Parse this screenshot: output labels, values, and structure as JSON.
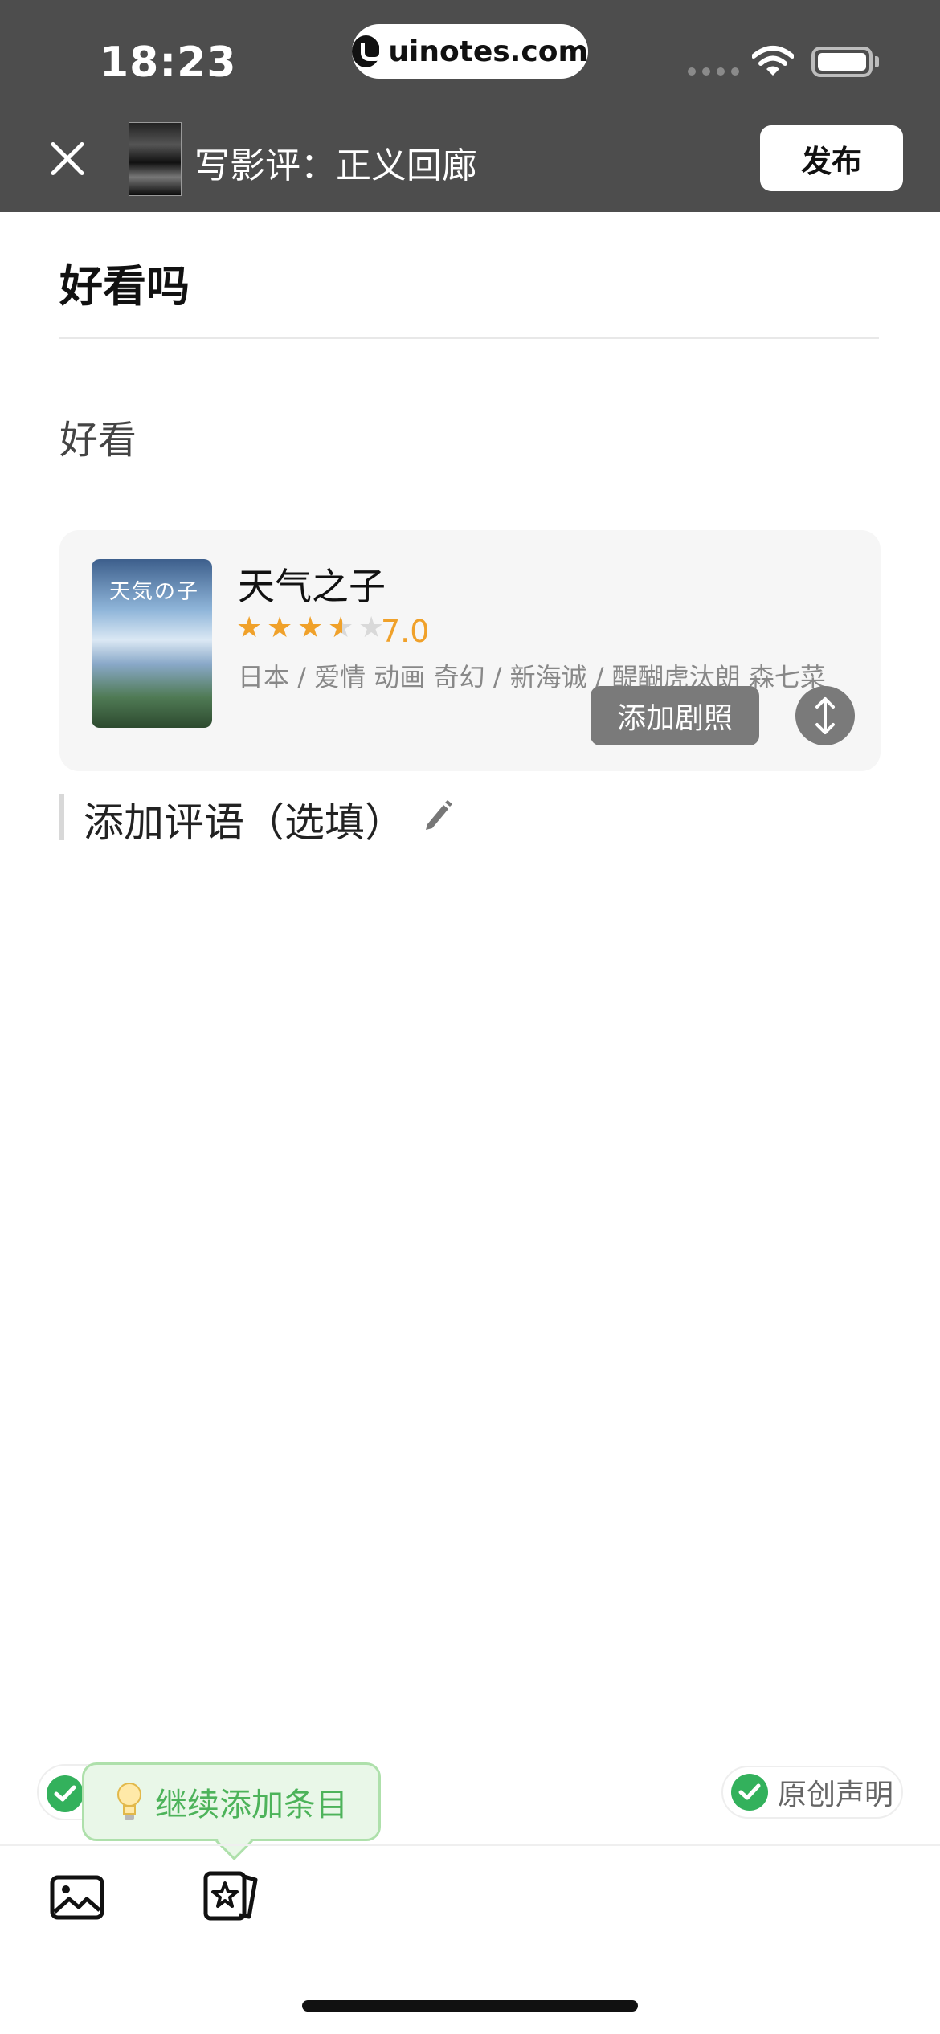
{
  "status_bar": {
    "time": "18:23",
    "url": "uinotes.com"
  },
  "header": {
    "title": "写影评：正义回廊",
    "publish_label": "发布"
  },
  "review": {
    "title": "好看吗",
    "body": "好看"
  },
  "movie_card": {
    "poster_caption": "天気の子",
    "name": "天气之子",
    "rating": "7.0",
    "stars": 3.5,
    "meta": "日本 / 爱情 动画 奇幻 / 新海诚 / 醍醐虎汰朗 森七菜",
    "add_still_label": "添加剧照"
  },
  "comment": {
    "prompt": "添加评语（选填）"
  },
  "bottom": {
    "tooltip_text": "继续添加条目",
    "original_label": "原创声明"
  },
  "colors": {
    "header_bg": "#4d4d4d",
    "star": "#f0a12a",
    "accent_green": "#33b15c",
    "tooltip_bg": "#e9f7e8"
  },
  "icons": [
    "close-icon",
    "wifi-icon",
    "battery-icon",
    "star-icon",
    "reorder-arrows-icon",
    "pencil-icon",
    "checkmark-icon",
    "lightbulb-icon",
    "image-icon",
    "star-card-icon"
  ]
}
